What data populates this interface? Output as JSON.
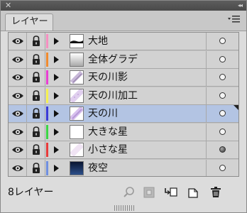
{
  "window": {
    "close_glyph": "✕",
    "collapse_glyph": "◂◂"
  },
  "tab": {
    "label": "レイヤー"
  },
  "layers": [
    {
      "name": "大地",
      "color": "#f58fc0",
      "thumb": "ground",
      "selected": false,
      "targeted": false
    },
    {
      "name": "全体グラデ",
      "color": "#f08a2e",
      "thumb": "gradient",
      "selected": false,
      "targeted": false
    },
    {
      "name": "天の川影",
      "color": "#e93fd3",
      "thumb": "milky-shadow",
      "selected": false,
      "targeted": false
    },
    {
      "name": "天の川加工",
      "color": "#f5f04e",
      "thumb": "milky-process",
      "selected": false,
      "targeted": false
    },
    {
      "name": "天の川",
      "color": "#3a3bd6",
      "thumb": "milky-way",
      "selected": true,
      "targeted": false
    },
    {
      "name": "大きな星",
      "color": "#3bd645",
      "thumb": "blank",
      "selected": false,
      "targeted": false
    },
    {
      "name": "小さな星",
      "color": "#e83a3a",
      "thumb": "small-stars",
      "selected": false,
      "targeted": true
    },
    {
      "name": "夜空",
      "color": "#6f8fe0",
      "thumb": "night-sky",
      "selected": false,
      "targeted": false
    }
  ],
  "footer": {
    "count_label": "8レイヤー"
  },
  "colors": {
    "selected_row": "#b3c4e3",
    "row_bg": "#d2d2d2"
  }
}
